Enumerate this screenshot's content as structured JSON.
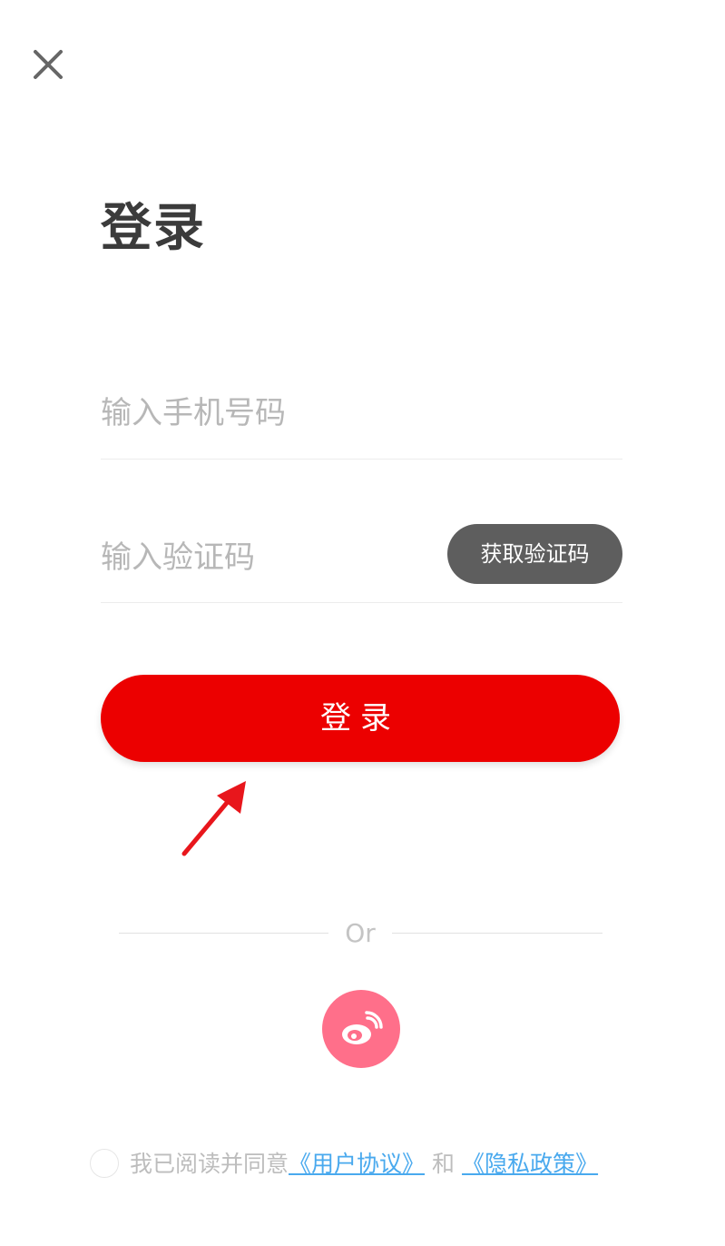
{
  "header": {
    "close_icon": "close-icon"
  },
  "page": {
    "title": "登录"
  },
  "form": {
    "phone_placeholder": "输入手机号码",
    "phone_value": "",
    "code_placeholder": "输入验证码",
    "code_value": "",
    "get_code_label": "获取验证码",
    "login_label": "登录"
  },
  "divider": {
    "or_label": "Or"
  },
  "social": {
    "weibo_icon": "weibo-icon"
  },
  "agreement": {
    "checked": false,
    "prefix": "我已阅读并同意",
    "user_agreement": "《用户协议》",
    "and": "和",
    "privacy_policy": "《隐私政策》"
  },
  "colors": {
    "primary_red": "#ec0000",
    "code_button": "#5e5e5e",
    "weibo_pink": "#ff6f8a",
    "link_blue": "#49a9ee",
    "annotation_arrow": "#e8161c"
  }
}
